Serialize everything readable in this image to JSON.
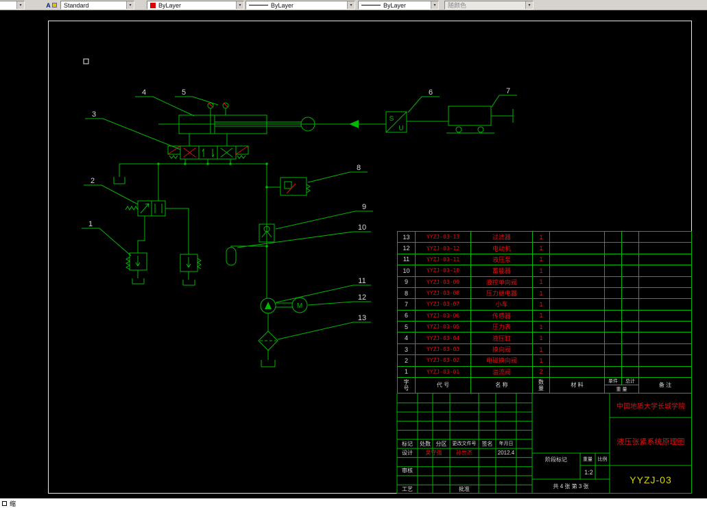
{
  "toolbar": {
    "style_value": "Standard",
    "color_value": "ByLayer",
    "linetype_value": "ByLayer",
    "lineweight_value": "ByLayer",
    "plotstyle_value": "随颜色"
  },
  "command_bar": {
    "text": "缩"
  },
  "schematic": {
    "labels": {
      "sensor_s": "S",
      "sensor_u": "U",
      "motor": "M"
    },
    "callouts": [
      "1",
      "2",
      "3",
      "4",
      "5",
      "6",
      "7",
      "8",
      "9",
      "10",
      "11",
      "12",
      "13"
    ]
  },
  "parts_table": {
    "headers": {
      "no": [
        "字",
        "号"
      ],
      "code": "代 号",
      "name": "名 称",
      "qty": [
        "数",
        "量"
      ],
      "material": "材 料",
      "unit": "单件",
      "total": "总计",
      "weight": "重 量",
      "remark": "备 注"
    },
    "rows": [
      {
        "no": "13",
        "code": "YYZJ-03-13",
        "name": "过滤器",
        "qty": "1"
      },
      {
        "no": "12",
        "code": "YYZJ-03-12",
        "name": "电动机",
        "qty": "1"
      },
      {
        "no": "11",
        "code": "YYZJ-03-11",
        "name": "液压泵",
        "qty": "1"
      },
      {
        "no": "10",
        "code": "YYZJ-03-10",
        "name": "蓄能器",
        "qty": "1"
      },
      {
        "no": "9",
        "code": "YYZJ-03-09",
        "name": "液控单向阀",
        "qty": "1"
      },
      {
        "no": "8",
        "code": "YYZJ-03-08",
        "name": "压力继电器",
        "qty": "1"
      },
      {
        "no": "7",
        "code": "YYZJ-03-07",
        "name": "小车",
        "qty": "1"
      },
      {
        "no": "6",
        "code": "YYZJ-03-06",
        "name": "传感器",
        "qty": "1"
      },
      {
        "no": "5",
        "code": "YYZJ-03-05",
        "name": "压力表",
        "qty": "1"
      },
      {
        "no": "4",
        "code": "YYZJ-03-04",
        "name": "液压缸",
        "qty": "1"
      },
      {
        "no": "3",
        "code": "YYZJ-03-03",
        "name": "换向阀",
        "qty": "1"
      },
      {
        "no": "2",
        "code": "YYZJ-03-02",
        "name": "电磁换向阀",
        "qty": "1"
      },
      {
        "no": "1",
        "code": "YYZJ-03-01",
        "name": "溢流阀",
        "qty": "2"
      }
    ]
  },
  "title_block": {
    "school": "中国地质大学长城学院",
    "drawing_title": "液压张紧系统原理图",
    "drawing_no": "YYZJ-03",
    "rev_headers": [
      "标记",
      "处数",
      "分区",
      "更改文件号",
      "签名",
      "年月日"
    ],
    "design_label": "设计",
    "design_name": "吴守强",
    "supervisor_name": "孙世杰",
    "date": "2012.4",
    "review_label": "审核",
    "process_label": "工艺",
    "approve_label": "批准",
    "stage_label": "阶段标记",
    "weight_label": "重量",
    "scale_label": "比例",
    "scale_value": "1:2",
    "sheet_info": "共 4 张 第 3 张"
  },
  "colors": {
    "line_green": "#00b800",
    "text_red": "#e01010",
    "callout_white": "#d9d9d9",
    "drawing_no_yellow": "#d8d800",
    "swatch_red": "#e00000"
  }
}
